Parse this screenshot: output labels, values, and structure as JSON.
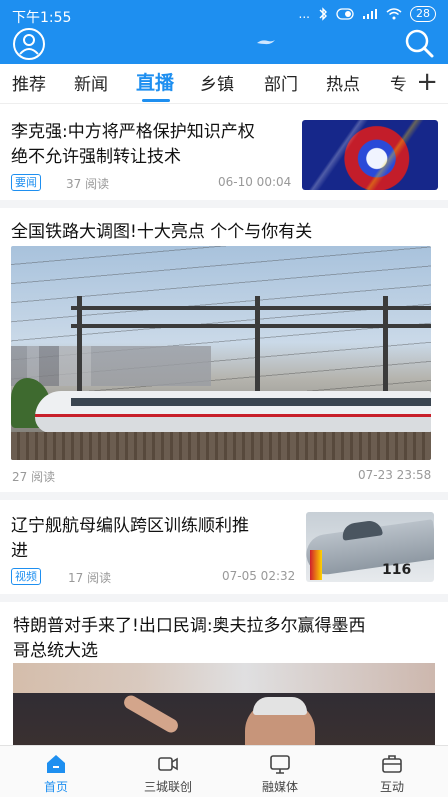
{
  "status_bar": {
    "time": "下午1:55",
    "signal_text": "...",
    "battery": "28"
  },
  "colors": {
    "brand_blue": "#1e8ff0",
    "text_primary": "#111111",
    "text_meta": "#999999",
    "divider": "#f3f4f6"
  },
  "header": {
    "icons": [
      "avatar-icon",
      "logo-icon",
      "search-icon"
    ]
  },
  "tabs": {
    "items": [
      "推荐",
      "新闻",
      "直播",
      "乡镇",
      "部门",
      "热点",
      "专"
    ],
    "active": "直播",
    "add_label": "+"
  },
  "articles": [
    {
      "title_line1": "李克强:中方将严格保护知识产权",
      "title_line2": "绝不允许强制转让技术",
      "tag": "要闻",
      "reads": "37 阅读",
      "time": "06-10 00:04"
    },
    {
      "title_line1": "全国铁路大调图!十大亮点 个个与你有关",
      "reads": "27 阅读",
      "time": "07-23 23:58"
    },
    {
      "title_line1": "辽宁舰航母编队跨区训练顺利推",
      "title_line2": "进",
      "tag": "视频",
      "reads": "17 阅读",
      "time": "07-05 02:32"
    },
    {
      "title_line1": "特朗普对手来了!出口民调:奥夫拉多尔赢得墨西",
      "title_line2": "哥总统大选"
    }
  ],
  "thumb_texts": {
    "jet_number": "116"
  },
  "bottom_nav": [
    {
      "label": "首页",
      "icon": "home-icon",
      "active": true
    },
    {
      "label": "三城联创",
      "icon": "video-icon",
      "active": false
    },
    {
      "label": "融媒体",
      "icon": "monitor-icon",
      "active": false
    },
    {
      "label": "互动",
      "icon": "briefcase-icon",
      "active": false
    }
  ]
}
